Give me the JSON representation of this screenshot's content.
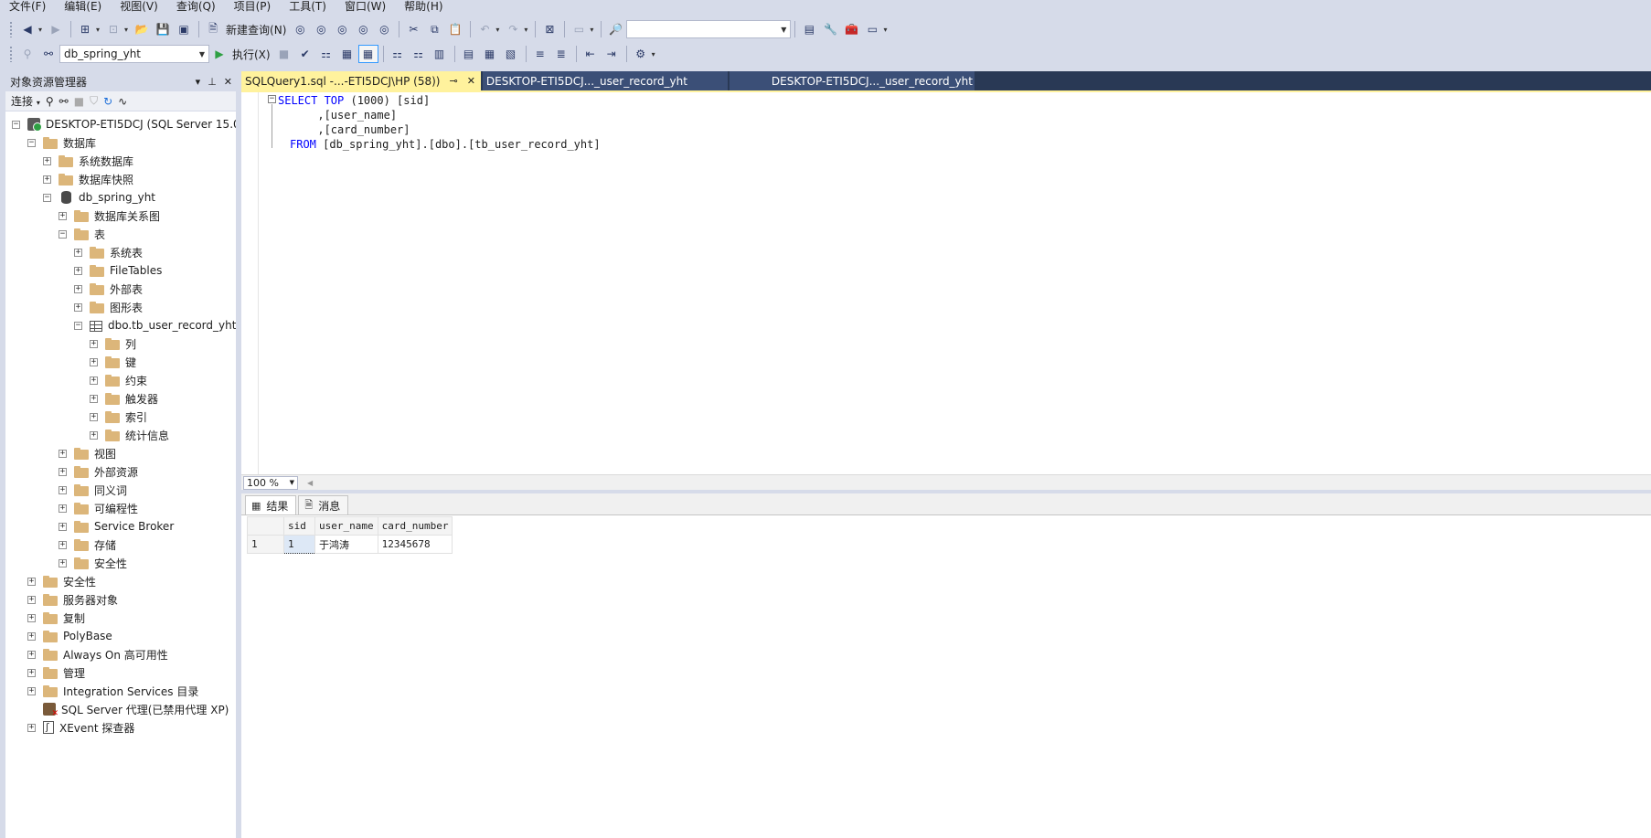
{
  "menu": [
    "文件(F)",
    "编辑(E)",
    "视图(V)",
    "查询(Q)",
    "项目(P)",
    "工具(T)",
    "窗口(W)",
    "帮助(H)"
  ],
  "toolbar": {
    "new_query_label": "新建查询(N)",
    "execute_label": "执行(X)",
    "database_selected": "db_spring_yht",
    "search_combo_value": ""
  },
  "object_explorer": {
    "title": "对象资源管理器",
    "connect_label": "连接",
    "tree": [
      {
        "label": "DESKTOP-ETI5DCJ (SQL Server 15.0",
        "level": 0,
        "expander": "−",
        "icon": "server-icon"
      },
      {
        "label": "数据库",
        "level": 1,
        "expander": "−",
        "icon": "folder-icon"
      },
      {
        "label": "系统数据库",
        "level": 2,
        "expander": "+",
        "icon": "folder-icon"
      },
      {
        "label": "数据库快照",
        "level": 2,
        "expander": "+",
        "icon": "folder-icon"
      },
      {
        "label": "db_spring_yht",
        "level": 2,
        "expander": "−",
        "icon": "database-icon"
      },
      {
        "label": "数据库关系图",
        "level": 3,
        "expander": "+",
        "icon": "folder-icon"
      },
      {
        "label": "表",
        "level": 3,
        "expander": "−",
        "icon": "folder-icon"
      },
      {
        "label": "系统表",
        "level": 4,
        "expander": "+",
        "icon": "folder-icon"
      },
      {
        "label": "FileTables",
        "level": 4,
        "expander": "+",
        "icon": "folder-icon"
      },
      {
        "label": "外部表",
        "level": 4,
        "expander": "+",
        "icon": "folder-icon"
      },
      {
        "label": "图形表",
        "level": 4,
        "expander": "+",
        "icon": "folder-icon"
      },
      {
        "label": "dbo.tb_user_record_yht",
        "level": 4,
        "expander": "−",
        "icon": "table-icon"
      },
      {
        "label": "列",
        "level": 5,
        "expander": "+",
        "icon": "folder-icon"
      },
      {
        "label": "键",
        "level": 5,
        "expander": "+",
        "icon": "folder-icon"
      },
      {
        "label": "约束",
        "level": 5,
        "expander": "+",
        "icon": "folder-icon"
      },
      {
        "label": "触发器",
        "level": 5,
        "expander": "+",
        "icon": "folder-icon"
      },
      {
        "label": "索引",
        "level": 5,
        "expander": "+",
        "icon": "folder-icon"
      },
      {
        "label": "统计信息",
        "level": 5,
        "expander": "+",
        "icon": "folder-icon"
      },
      {
        "label": "视图",
        "level": 3,
        "expander": "+",
        "icon": "folder-icon"
      },
      {
        "label": "外部资源",
        "level": 3,
        "expander": "+",
        "icon": "folder-icon"
      },
      {
        "label": "同义词",
        "level": 3,
        "expander": "+",
        "icon": "folder-icon"
      },
      {
        "label": "可编程性",
        "level": 3,
        "expander": "+",
        "icon": "folder-icon"
      },
      {
        "label": "Service Broker",
        "level": 3,
        "expander": "+",
        "icon": "folder-icon"
      },
      {
        "label": "存储",
        "level": 3,
        "expander": "+",
        "icon": "folder-icon"
      },
      {
        "label": "安全性",
        "level": 3,
        "expander": "+",
        "icon": "folder-icon"
      },
      {
        "label": "安全性",
        "level": 1,
        "expander": "+",
        "icon": "folder-icon"
      },
      {
        "label": "服务器对象",
        "level": 1,
        "expander": "+",
        "icon": "folder-icon"
      },
      {
        "label": "复制",
        "level": 1,
        "expander": "+",
        "icon": "folder-icon"
      },
      {
        "label": "PolyBase",
        "level": 1,
        "expander": "+",
        "icon": "folder-icon"
      },
      {
        "label": "Always On 高可用性",
        "level": 1,
        "expander": "+",
        "icon": "folder-icon"
      },
      {
        "label": "管理",
        "level": 1,
        "expander": "+",
        "icon": "folder-icon"
      },
      {
        "label": "Integration Services 目录",
        "level": 1,
        "expander": "+",
        "icon": "folder-icon"
      },
      {
        "label": "SQL Server 代理(已禁用代理 XP)",
        "level": 1,
        "expander": "",
        "icon": "agent-icon"
      },
      {
        "label": "XEvent 探查器",
        "level": 1,
        "expander": "+",
        "icon": "xevent-icon"
      }
    ]
  },
  "doc_tabs": [
    {
      "label": "SQLQuery1.sql -...-ETI5DCJ\\HP (58))",
      "active": true
    },
    {
      "label": "DESKTOP-ETI5DCJ..._user_record_yht",
      "active": false
    },
    {
      "label": "DESKTOP-ETI5DCJ..._user_record_yht",
      "active": false
    }
  ],
  "editor": {
    "line1_kw": "SELECT TOP",
    "line1_rest": " (1000) [sid]",
    "line2": "      ,[user_name]",
    "line3": "      ,[card_number]",
    "line4_kw": "FROM",
    "line4_rest": " [db_spring_yht].[dbo].[tb_user_record_yht]"
  },
  "zoom": "100 %",
  "result_tabs": [
    "结果",
    "消息"
  ],
  "results": {
    "columns": [
      "sid",
      "user_name",
      "card_number"
    ],
    "rows": [
      {
        "rownum": "1",
        "cells": [
          "1",
          "于鸿涛",
          "12345678"
        ]
      }
    ]
  },
  "colors": {
    "chrome": "#d6dbe9",
    "active_tab": "#fff29d",
    "tab_strip": "#293955",
    "keyword": "#0000ff"
  }
}
